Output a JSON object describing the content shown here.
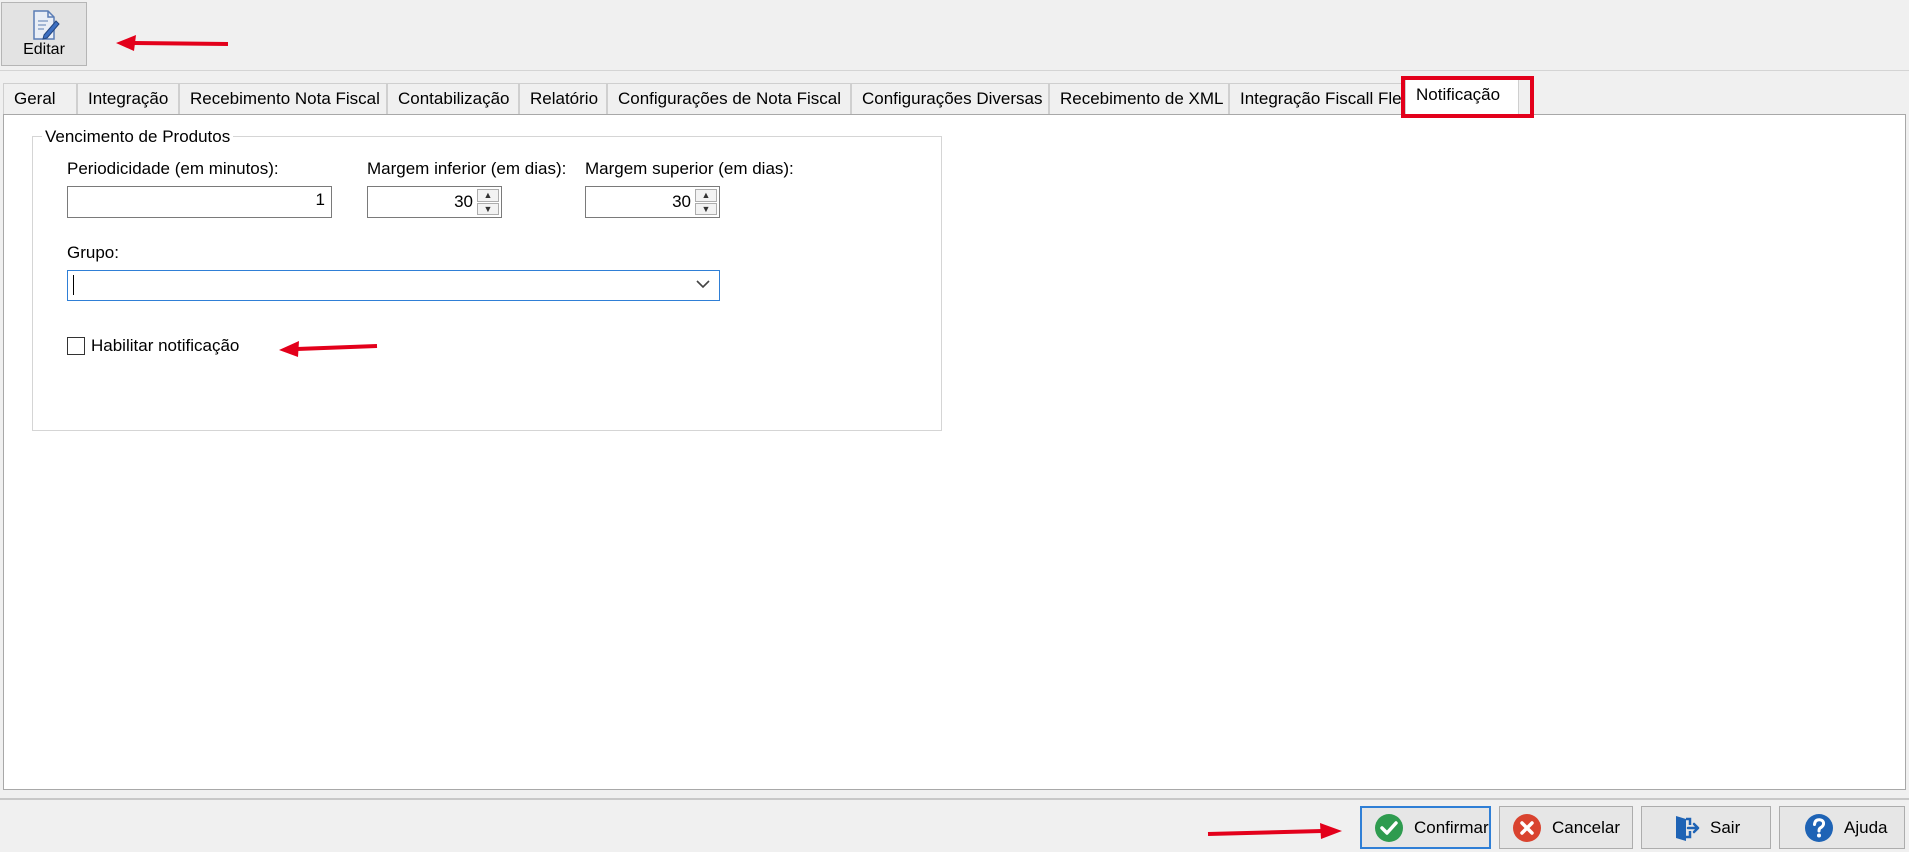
{
  "toolbar": {
    "edit_label": "Editar"
  },
  "tabs": [
    {
      "label": "Geral"
    },
    {
      "label": "Integração"
    },
    {
      "label": "Recebimento Nota Fiscal"
    },
    {
      "label": "Contabilização"
    },
    {
      "label": "Relatório"
    },
    {
      "label": "Configurações de Nota Fiscal"
    },
    {
      "label": "Configurações Diversas"
    },
    {
      "label": "Recebimento de XML"
    },
    {
      "label": "Integração Fiscall Flex"
    },
    {
      "label": "Notificação",
      "active": true
    }
  ],
  "group": {
    "title": "Vencimento de Produtos",
    "periodicidade_label": "Periodicidade (em minutos):",
    "periodicidade_value": "1",
    "margem_inferior_label": "Margem inferior (em dias):",
    "margem_inferior_value": "30",
    "margem_superior_label": "Margem superior (em dias):",
    "margem_superior_value": "30",
    "grupo_label": "Grupo:",
    "grupo_value": "",
    "habilitar_label": "Habilitar notificação",
    "habilitar_checked": false
  },
  "bottom_buttons": {
    "confirmar": "Confirmar",
    "cancelar": "Cancelar",
    "sair": "Sair",
    "ajuda": "Ajuda"
  },
  "colors": {
    "highlight": "#e3001b",
    "arrow": "#e3001b",
    "focus_border": "#2f7fd6",
    "confirm_green": "#2e9b4f",
    "cancel_red": "#d9432f",
    "help_blue": "#1e63b5"
  },
  "icons": {
    "edit": "edit-document-icon",
    "confirm": "check-circle-icon",
    "cancel": "x-circle-icon",
    "exit": "exit-door-icon",
    "help": "question-circle-icon",
    "combo": "chevron-down-icon"
  }
}
